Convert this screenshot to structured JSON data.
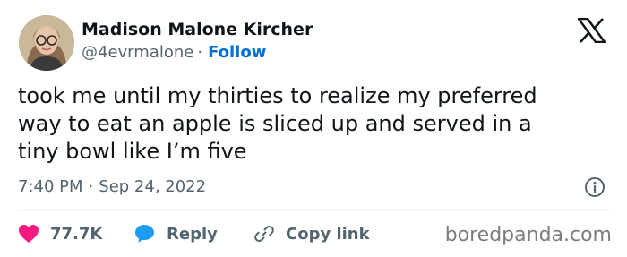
{
  "author": {
    "name": "Madison Malone Kircher",
    "handle": "@4evrmalone",
    "separator": "·",
    "follow_label": "Follow"
  },
  "tweet": {
    "text": "took me until my thirties to realize my preferred\nway to eat an apple is sliced up and served in a\ntiny bowl like I’m five",
    "time": "7:40 PM",
    "separator": "·",
    "date": "Sep 24, 2022"
  },
  "actions": {
    "like_count": "77.7K",
    "reply_label": "Reply",
    "copy_label": "Copy link"
  },
  "icons": {
    "brand": "x-logo-icon",
    "info": "info-icon",
    "like": "heart-icon",
    "reply": "speech-bubble-icon",
    "copy": "link-icon"
  },
  "colors": {
    "like": "#f91880",
    "reply": "#1d9bf0",
    "follow": "#006fd6",
    "secondary_text": "#536471"
  },
  "watermark": "boredpanda.com"
}
